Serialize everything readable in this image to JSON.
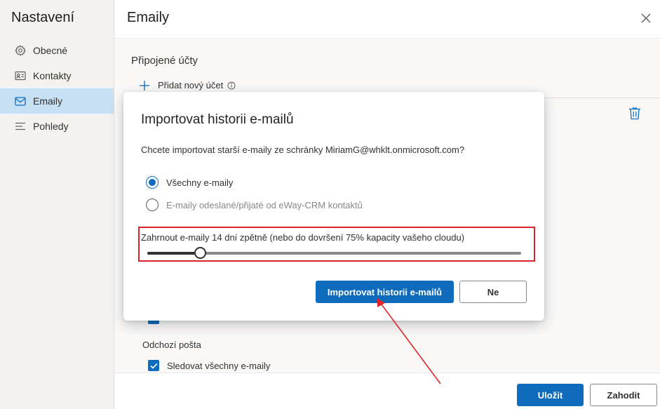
{
  "sidebar": {
    "title": "Nastavení",
    "items": [
      {
        "label": "Obecné",
        "icon": "gear-icon",
        "active": false
      },
      {
        "label": "Kontakty",
        "icon": "contact-card-icon",
        "active": false
      },
      {
        "label": "Emaily",
        "icon": "mail-icon",
        "active": true
      },
      {
        "label": "Pohledy",
        "icon": "list-icon",
        "active": false
      }
    ]
  },
  "header": {
    "title": "Emaily",
    "close_icon": "close-icon"
  },
  "main": {
    "connected_accounts_title": "Připojené účty",
    "add_account_label": "Přidat nový účet",
    "outgoing_title": "Odchozí pošta",
    "track_all_label": "Sledovat všechny e-maily",
    "track_all_checked": true
  },
  "footer": {
    "save_label": "Uložit",
    "discard_label": "Zahodit"
  },
  "dialog": {
    "title": "Importovat historii e-mailů",
    "question": "Chcete importovat starší e-maily ze schránky MiriamG@whklt.onmicrosoft.com?",
    "options": [
      {
        "label": "Všechny e-maily",
        "checked": true
      },
      {
        "label": "E-maily odeslané/přijaté od eWay-CRM kontaktů",
        "checked": false
      }
    ],
    "slider_label": "Zahrnout e-maily 14 dní zpětně (nebo do dovršení 75% kapacity vašeho cloudu)",
    "slider_fraction": 0.14,
    "import_label": "Importovat historii e-mailů",
    "no_label": "Ne"
  },
  "colors": {
    "accent": "#0f6cbd",
    "active_nav": "#c7e0f4",
    "highlight": "#d9242b"
  }
}
